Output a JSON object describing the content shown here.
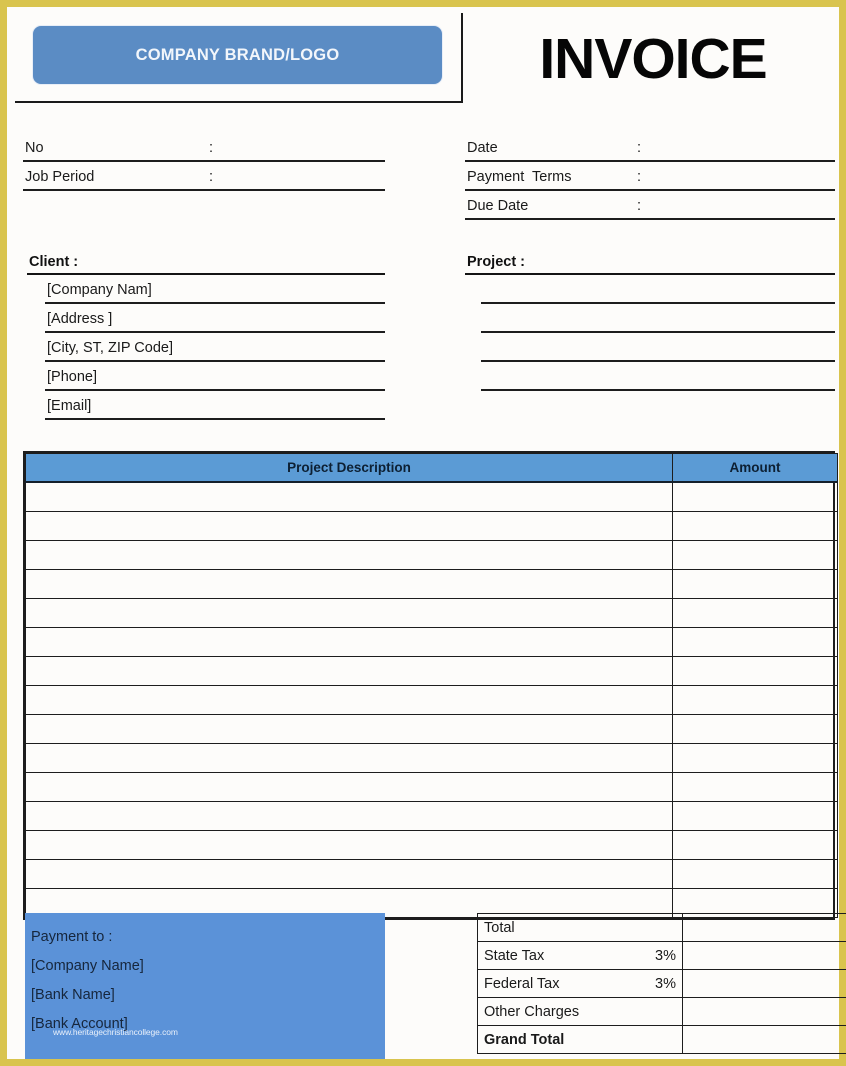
{
  "document": {
    "title": "INVOICE",
    "logo_text": "COMPANY BRAND/LOGO"
  },
  "meta_left": [
    {
      "label": "No",
      "colon": ":",
      "value": ""
    },
    {
      "label": "Job Period",
      "colon": ":",
      "value": ""
    }
  ],
  "meta_right": [
    {
      "label": "Date",
      "colon": ":",
      "value": ""
    },
    {
      "label": "Payment  Terms",
      "colon": ":",
      "value": ""
    },
    {
      "label": "Due Date",
      "colon": ":",
      "value": ""
    }
  ],
  "client": {
    "title": "Client :",
    "lines": [
      "[Company Nam]",
      "[Address ]",
      "[City, ST, ZIP Code]",
      "[Phone]",
      "[Email]"
    ]
  },
  "project": {
    "title": "Project :",
    "lines": [
      "",
      "",
      "",
      ""
    ]
  },
  "items_table": {
    "columns": [
      "Project Description",
      "Amount"
    ],
    "rows": [
      {
        "description": "",
        "amount": ""
      },
      {
        "description": "",
        "amount": ""
      },
      {
        "description": "",
        "amount": ""
      },
      {
        "description": "",
        "amount": ""
      },
      {
        "description": "",
        "amount": ""
      },
      {
        "description": "",
        "amount": ""
      },
      {
        "description": "",
        "amount": ""
      },
      {
        "description": "",
        "amount": ""
      },
      {
        "description": "",
        "amount": ""
      },
      {
        "description": "",
        "amount": ""
      },
      {
        "description": "",
        "amount": ""
      },
      {
        "description": "",
        "amount": ""
      },
      {
        "description": "",
        "amount": ""
      },
      {
        "description": "",
        "amount": ""
      },
      {
        "description": "",
        "amount": ""
      }
    ]
  },
  "payment": {
    "heading": "Payment to :",
    "lines": [
      "[Company Name]",
      "[Bank Name]",
      "[Bank Account]"
    ],
    "watermark": "www.heritagechristiancollege.com"
  },
  "totals": {
    "rows": [
      {
        "label": "Total",
        "rate": "",
        "value": "",
        "bold": false
      },
      {
        "label": "State Tax",
        "rate": "3%",
        "value": "",
        "bold": false
      },
      {
        "label": "Federal Tax",
        "rate": "3%",
        "value": "",
        "bold": false
      },
      {
        "label": "Other Charges",
        "rate": "",
        "value": "",
        "bold": false
      },
      {
        "label": "Grand Total",
        "rate": "",
        "value": "",
        "bold": true
      }
    ]
  },
  "colors": {
    "page_border": "#d9c44e",
    "logo_blue": "#5b8cc4",
    "table_header_blue": "#5b9bd5",
    "payment_blue": "#5b92d8",
    "rule": "#1d1d1d"
  }
}
